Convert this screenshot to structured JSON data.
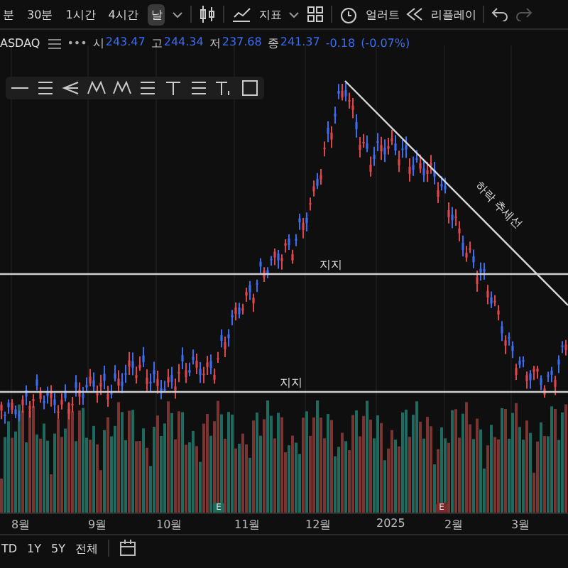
{
  "toolbar": {
    "intervals": [
      {
        "label": "분",
        "selected": false
      },
      {
        "label": "30분",
        "selected": false
      },
      {
        "label": "1시간",
        "selected": false
      },
      {
        "label": "4시간",
        "selected": false
      },
      {
        "label": "날",
        "selected": true
      }
    ],
    "indicators": "지표",
    "alert": "얼러트",
    "replay": "리플레이"
  },
  "legend": {
    "symbol": "ASDAQ",
    "more": "•••",
    "values": [
      {
        "key": "시",
        "value": "243.47"
      },
      {
        "key": "고",
        "value": "244.34"
      },
      {
        "key": "저",
        "value": "237.68"
      },
      {
        "key": "종",
        "value": "241.37"
      }
    ],
    "change": "-0.18",
    "change_percent": "(-0.07%)"
  },
  "chart": {
    "support_lines": [
      {
        "label": "지지"
      },
      {
        "label": "지지"
      }
    ],
    "trend_line": {
      "label": "하락 추세선"
    },
    "markers": [
      {
        "label": "E",
        "color": "#1e6b5c"
      },
      {
        "label": "E",
        "color": "#7a2a2a"
      }
    ],
    "x_axis": [
      "8월",
      "9월",
      "10월",
      "11월",
      "12월",
      "2025",
      "2월",
      "3월"
    ]
  },
  "ranges": [
    "TD",
    "1Y",
    "5Y",
    "전체"
  ]
}
